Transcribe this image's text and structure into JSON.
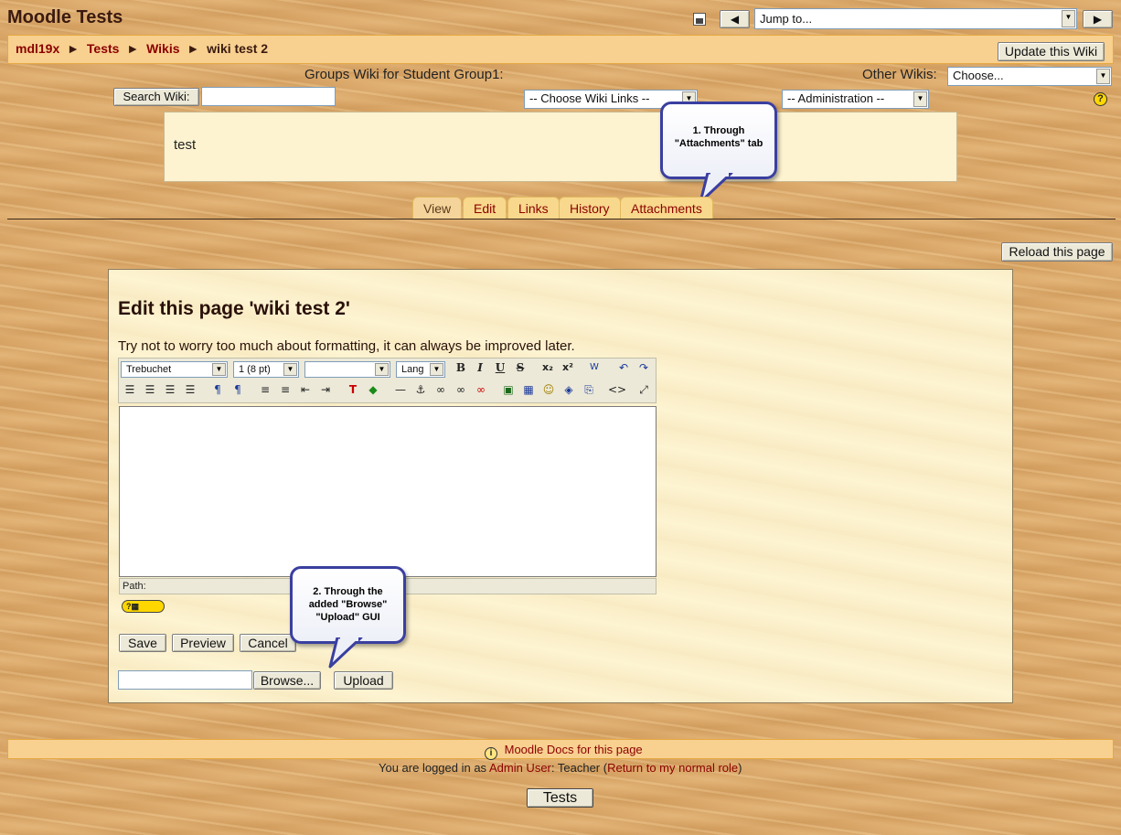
{
  "header": {
    "site_title": "Moodle Tests",
    "jump_to": "Jump to...",
    "prev_icon": "left-triangle",
    "next_icon": "right-triangle",
    "print_icon": "printer-icon"
  },
  "breadcrumb": {
    "items": [
      "mdl19x",
      "Tests",
      "Wikis",
      "wiki test 2"
    ],
    "separator": "►"
  },
  "update_button": "Update this Wiki",
  "wiki_bar": {
    "groups_label": "Groups Wiki for Student Group1:",
    "other_wikis_label": "Other Wikis:",
    "other_wikis_select": "Choose...",
    "search_button": "Search Wiki:",
    "search_value": "",
    "links_select": "-- Choose Wiki Links --",
    "admin_select": "-- Administration --",
    "help_icon": "help-icon"
  },
  "summary_box": {
    "text": "test"
  },
  "callout1": {
    "line1": "1. Through",
    "line2": "\"Attachments\" tab"
  },
  "tabs": [
    {
      "label": "View",
      "active": true
    },
    {
      "label": "Edit",
      "active": false
    },
    {
      "label": "Links",
      "active": false
    },
    {
      "label": "History",
      "active": false
    },
    {
      "label": "Attachments",
      "active": false
    }
  ],
  "reload_button": "Reload this page",
  "editor_panel": {
    "heading": "Edit this page 'wiki test 2'",
    "hint": "Try not to worry too much about formatting, it can always be improved later.",
    "font_select": "Trebuchet",
    "size_select": "1 (8 pt)",
    "style_select": "",
    "lang_select": "Lang",
    "path_label": "Path:",
    "save": "Save",
    "preview": "Preview",
    "cancel": "Cancel",
    "browse": "Browse...",
    "upload": "Upload"
  },
  "callout2": {
    "line1": "2. Through the",
    "line2": "added \"Browse\"",
    "line3": "\"Upload\" GUI"
  },
  "footer": {
    "docs_link": "Moodle Docs for this page",
    "logged_prefix": "You are logged in as ",
    "user": "Admin User",
    "role_text": ": Teacher (",
    "return_link": "Return to my normal role",
    "close_paren": ")",
    "course_button": "Tests"
  },
  "colors": {
    "link": "#8b0000",
    "bar": "#f8d090",
    "panel": "#fdf3d0",
    "callout_border": "#3a3fa0"
  }
}
